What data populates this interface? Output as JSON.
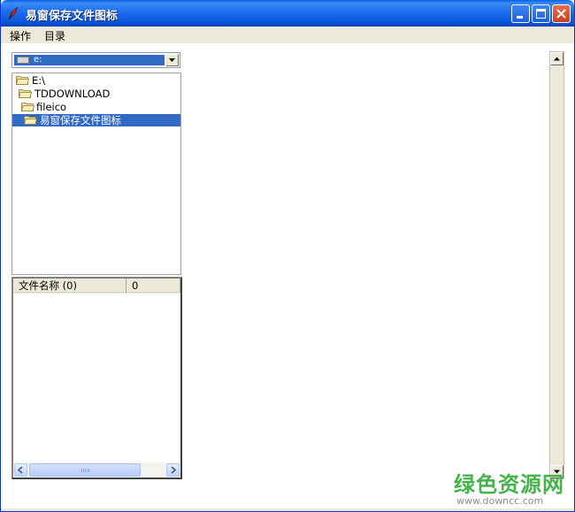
{
  "window": {
    "title": "易窗保存文件图标"
  },
  "menu": [
    {
      "label": "操作"
    },
    {
      "label": "目录"
    }
  ],
  "drive_combo": {
    "value": "e:"
  },
  "tree": {
    "items": [
      {
        "label": "E:\\",
        "selected": false
      },
      {
        "label": "TDDOWNLOAD",
        "selected": false
      },
      {
        "label": "fileico",
        "selected": false
      },
      {
        "label": "易窗保存文件图标",
        "selected": true
      }
    ]
  },
  "file_list": {
    "columns": [
      {
        "label": "文件名称 (0)"
      },
      {
        "label": "0"
      }
    ]
  },
  "watermark": {
    "main": "绿色资源网",
    "sub": "www.downcc.com"
  },
  "colors": {
    "selection": "#316AC5",
    "titlebar": "#0A55D9",
    "watermark": "#46B34A"
  }
}
